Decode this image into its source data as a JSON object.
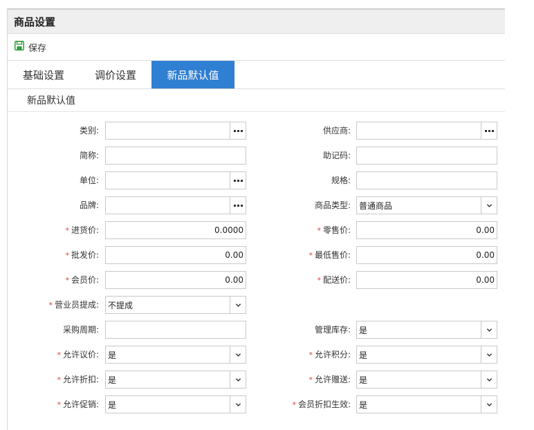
{
  "window": {
    "title": "商品设置"
  },
  "toolbar": {
    "save_label": "保存"
  },
  "tabs": [
    {
      "label": "基础设置"
    },
    {
      "label": "调价设置"
    },
    {
      "label": "新品默认值"
    }
  ],
  "section": {
    "title": "新品默认值"
  },
  "form": {
    "category": {
      "label": "类别:",
      "value": ""
    },
    "supplier": {
      "label": "供应商:",
      "value": ""
    },
    "short_name": {
      "label": "简称:",
      "value": ""
    },
    "mnemonic": {
      "label": "助记码:",
      "value": ""
    },
    "unit": {
      "label": "单位:",
      "value": ""
    },
    "spec": {
      "label": "规格:",
      "value": ""
    },
    "brand": {
      "label": "品牌:",
      "value": ""
    },
    "product_type": {
      "label": "商品类型:",
      "value": "普通商品"
    },
    "purchase_price": {
      "label": "进货价:",
      "value": "0.0000",
      "required": "*"
    },
    "retail_price": {
      "label": "零售价:",
      "value": "0.00",
      "required": "*"
    },
    "wholesale_price": {
      "label": "批发价:",
      "value": "0.00",
      "required": "*"
    },
    "min_sale_price": {
      "label": "最低售价:",
      "value": "0.00",
      "required": "*"
    },
    "member_price": {
      "label": "会员价:",
      "value": "0.00",
      "required": "*"
    },
    "delivery_price": {
      "label": "配送价:",
      "value": "0.00",
      "required": "*"
    },
    "salesperson_commission": {
      "label": "营业员提成:",
      "value": "不提成",
      "required": "*"
    },
    "purchase_cycle": {
      "label": "采购周期:",
      "value": ""
    },
    "manage_stock": {
      "label": "管理库存:",
      "value": "是"
    },
    "allow_bargain": {
      "label": "允许议价:",
      "value": "是",
      "required": "*"
    },
    "allow_points": {
      "label": "允许积分:",
      "value": "是",
      "required": "*"
    },
    "allow_discount": {
      "label": "允许折扣:",
      "value": "是",
      "required": "*"
    },
    "allow_gift": {
      "label": "允许赠送:",
      "value": "是",
      "required": "*"
    },
    "allow_promotion": {
      "label": "允许促销:",
      "value": "是",
      "required": "*"
    },
    "member_discount_effective": {
      "label": "会员折扣生效:",
      "value": "是",
      "required": "*"
    }
  }
}
